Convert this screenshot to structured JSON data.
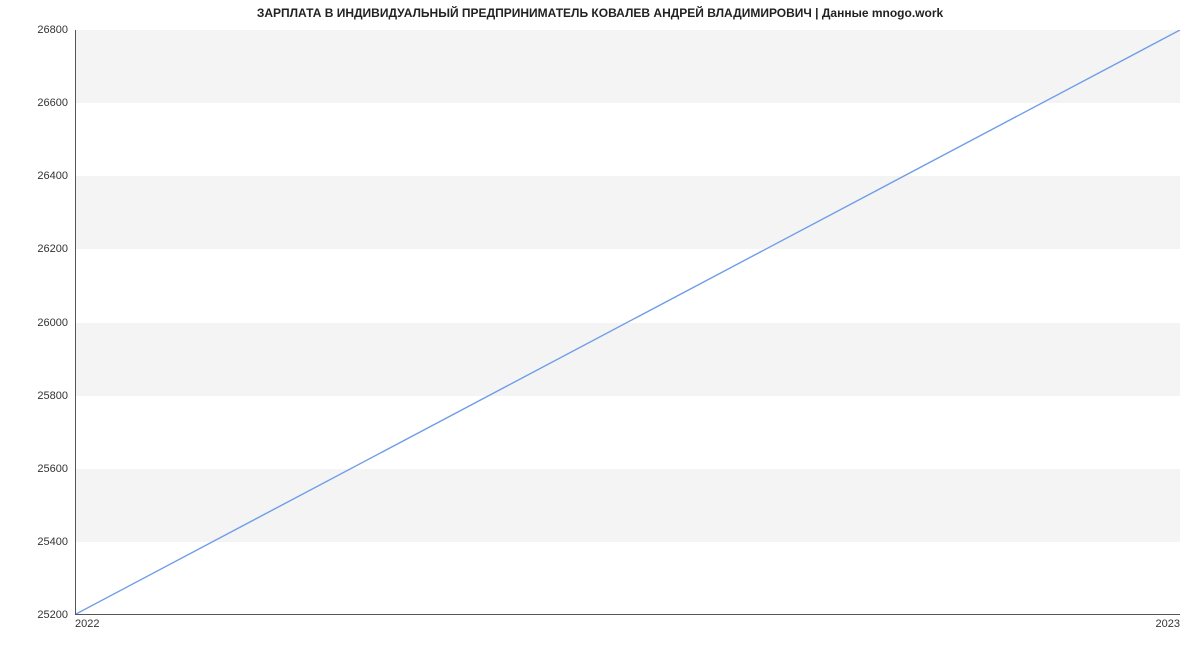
{
  "chart_data": {
    "type": "line",
    "title": "ЗАРПЛАТА В ИНДИВИДУАЛЬНЫЙ ПРЕДПРИНИМАТЕЛЬ КОВАЛЕВ АНДРЕЙ ВЛАДИМИРОВИЧ | Данные mnogo.work",
    "x": [
      2022,
      2023
    ],
    "values": [
      25200,
      26800
    ],
    "x_ticks": [
      "2022",
      "2023"
    ],
    "y_ticks": [
      25200,
      25400,
      25600,
      25800,
      26000,
      26200,
      26400,
      26600,
      26800
    ],
    "xlabel": "",
    "ylabel": "",
    "ylim": [
      25200,
      26800
    ],
    "xlim": [
      2022,
      2023
    ],
    "line_color": "#6f9de8"
  }
}
